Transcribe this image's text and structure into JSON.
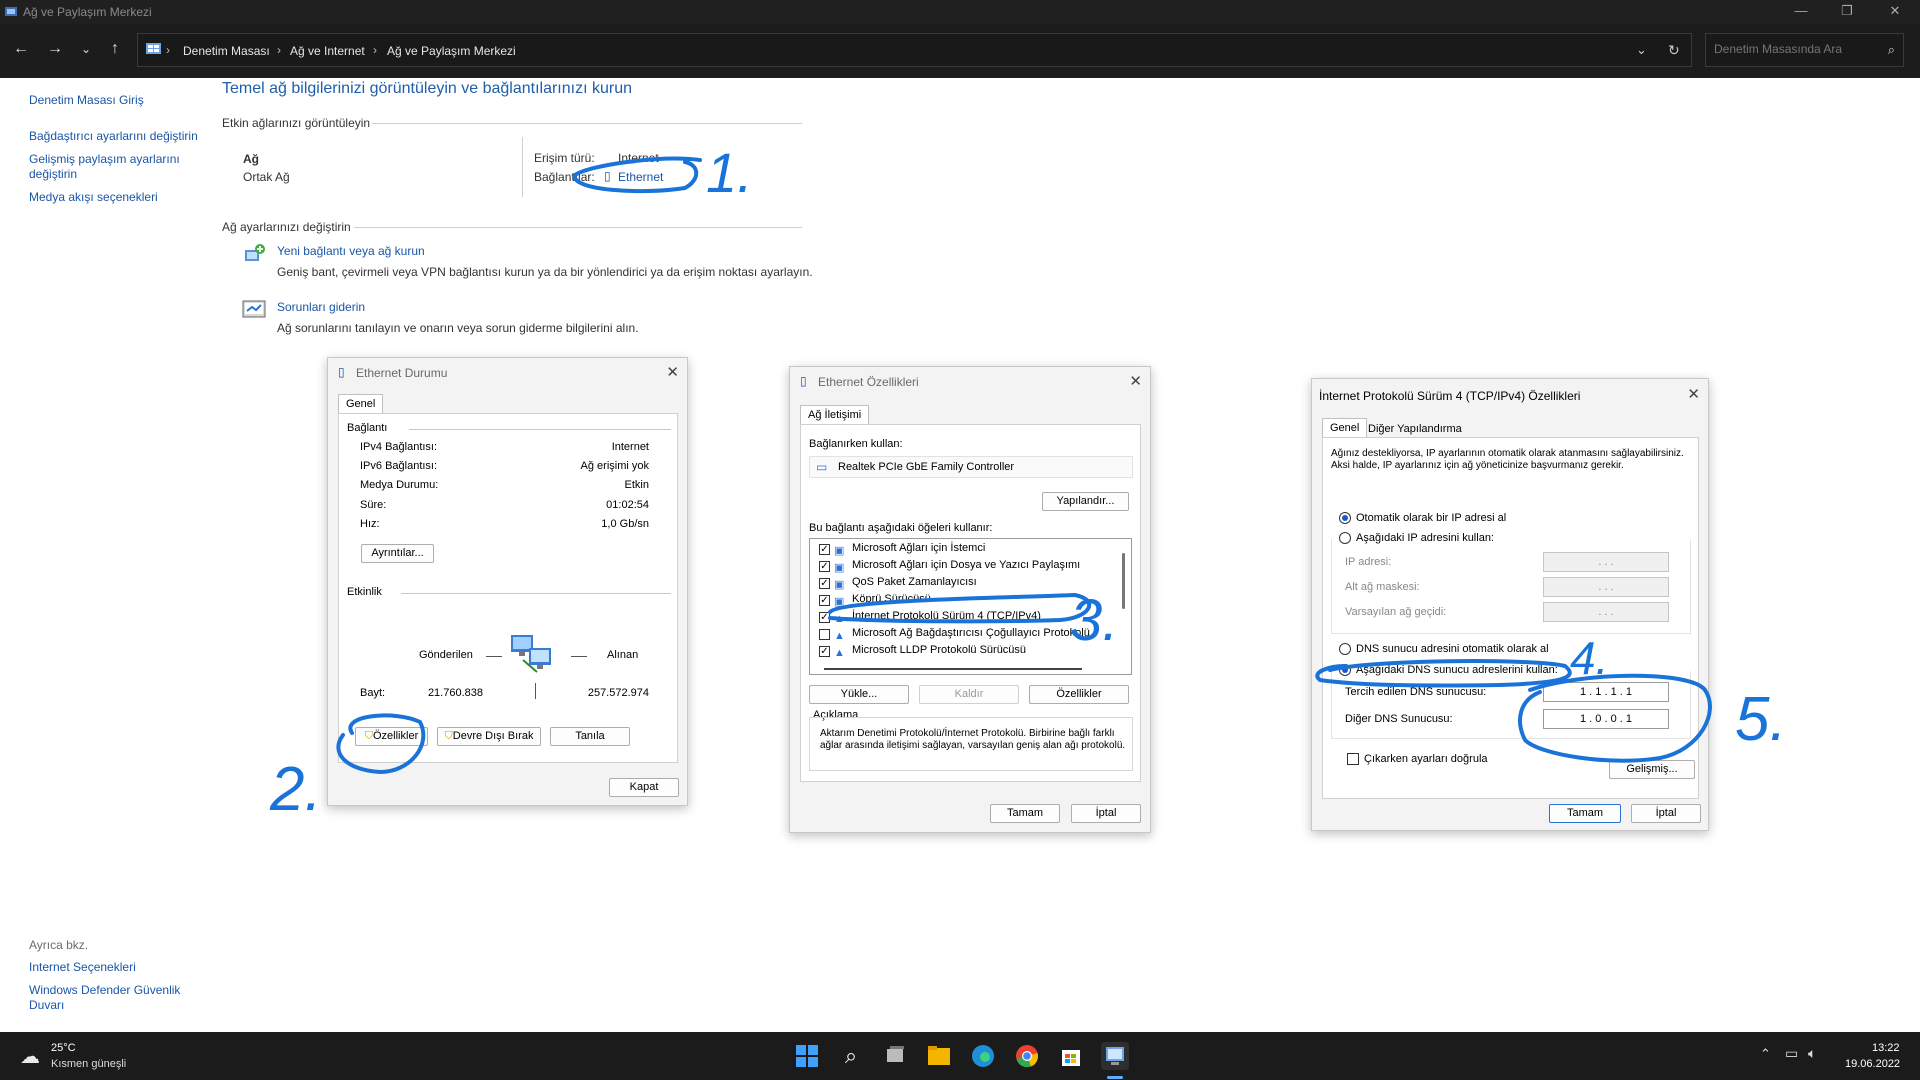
{
  "window": {
    "title": "Ağ ve Paylaşım Merkezi",
    "controls": {
      "minimize": "—",
      "maximize": "❐",
      "close": "✕"
    }
  },
  "address": {
    "crumbs": [
      "Denetim Masası",
      "Ağ ve Internet",
      "Ağ ve Paylaşım Merkezi"
    ],
    "search_placeholder": "Denetim Masasında Ara"
  },
  "sidebar": {
    "items": [
      "Denetim Masası Giriş",
      "Bağdaştırıcı ayarlarını değiştirin",
      "Gelişmiş paylaşım ayarlarını",
      "değiştirin",
      "Medya akışı seçenekleri"
    ],
    "see_also": "Ayrıca bkz.",
    "see_also_items": [
      "Internet Seçenekleri",
      "Windows Defender Güvenlik",
      "Duvarı"
    ]
  },
  "main": {
    "title": "Temel ağ bilgilerinizi görüntüleyin ve bağlantılarınızı kurun",
    "active_networks": "Etkin ağlarınızı görüntüleyin",
    "network_name": "Ağ",
    "network_type": "Ortak Ağ",
    "access_type_label": "Erişim türü:",
    "access_type_value": "Internet",
    "connections_label": "Bağlantılar:",
    "connections_value": "Ethernet",
    "change_settings": "Ağ ayarlarınızı değiştirin",
    "new_conn_link": "Yeni bağlantı veya ağ kurun",
    "new_conn_desc": "Geniş bant, çevirmeli veya VPN bağlantısı kurun ya da bir yönlendirici ya da erişim noktası ayarlayın.",
    "trouble_link": "Sorunları giderin",
    "trouble_desc": "Ağ sorunlarını tanılayın ve onarın veya sorun giderme bilgilerini alın."
  },
  "status_dialog": {
    "title": "Ethernet Durumu",
    "tab": "Genel",
    "conn_group": "Bağlantı",
    "rows": [
      {
        "k": "IPv4 Bağlantısı:",
        "v": "Internet"
      },
      {
        "k": "IPv6 Bağlantısı:",
        "v": "Ağ erişimi yok"
      },
      {
        "k": "Medya Durumu:",
        "v": "Etkin"
      },
      {
        "k": "Süre:",
        "v": "01:02:54"
      },
      {
        "k": "Hız:",
        "v": "1,0 Gb/sn"
      }
    ],
    "details_btn": "Ayrıntılar...",
    "activity_group": "Etkinlik",
    "sent": "Gönderilen",
    "received": "Alınan",
    "bytes_label": "Bayt:",
    "bytes_sent": "21.760.838",
    "bytes_recv": "257.572.974",
    "props_btn": "Özellikler",
    "disable_btn": "Devre Dışı Bırak",
    "diagnose_btn": "Tanıla",
    "close_btn": "Kapat"
  },
  "eth_props_dialog": {
    "title": "Ethernet Özellikleri",
    "tab": "Ağ İletişimi",
    "connect_using": "Bağlanırken kullan:",
    "adapter": "Realtek PCIe GbE Family Controller",
    "configure_btn": "Yapılandır...",
    "items_label": "Bu bağlantı aşağıdaki öğeleri kullanır:",
    "items": [
      {
        "label": "Microsoft Ağları için İstemci",
        "checked": true
      },
      {
        "label": "Microsoft Ağları için Dosya ve Yazıcı Paylaşımı",
        "checked": true
      },
      {
        "label": "QoS Paket Zamanlayıcısı",
        "checked": true
      },
      {
        "label": "Köprü Sürücüsü",
        "checked": true
      },
      {
        "label": "İnternet Protokolü Sürüm 4 (TCP/IPv4)",
        "checked": true
      },
      {
        "label": "Microsoft Ağ Bağdaştırıcısı Çoğullayıcı Protokolü",
        "checked": false
      },
      {
        "label": "Microsoft LLDP Protokolü Sürücüsü",
        "checked": true
      }
    ],
    "install_btn": "Yükle...",
    "uninstall_btn": "Kaldır",
    "props_btn": "Özellikler",
    "desc_group": "Açıklama",
    "desc": "Aktarım Denetimi Protokolü/İnternet Protokolü. Birbirine bağlı farklı ağlar arasında iletişimi sağlayan, varsayılan geniş alan ağı protokolü.",
    "ok_btn": "Tamam",
    "cancel_btn": "İptal"
  },
  "ipv4_dialog": {
    "title": "İnternet Protokolü Sürüm 4 (TCP/IPv4) Özellikleri",
    "tab_general": "Genel",
    "tab_alt": "Diğer Yapılandırma",
    "intro": "Ağınız destekliyorsa, IP ayarlarının otomatik olarak atanmasını sağlayabilirsiniz. Aksi halde, IP ayarlarınız için ağ yöneticinize başvurmanız gerekir.",
    "auto_ip": "Otomatik olarak bir IP adresi al",
    "manual_ip": "Aşağıdaki IP adresini kullan:",
    "ip_label": "IP adresi:",
    "mask_label": "Alt ağ maskesi:",
    "gw_label": "Varsayılan ağ geçidi:",
    "empty_ip": ". . .",
    "auto_dns": "DNS sunucu adresini otomatik olarak al",
    "manual_dns": "Aşağıdaki DNS sunucu adreslerini kullan:",
    "pref_dns_label": "Tercih edilen DNS sunucusu:",
    "alt_dns_label": "Diğer DNS Sunucusu:",
    "pref_dns": "1 . 1 . 1 . 1",
    "alt_dns": "1 . 0 . 0 . 1",
    "validate": "Çıkarken ayarları doğrula",
    "advanced_btn": "Gelişmiş...",
    "ok_btn": "Tamam",
    "cancel_btn": "İptal"
  },
  "annotations": [
    "1.",
    "2.",
    "3.",
    "4.",
    "5."
  ],
  "taskbar": {
    "temp": "25°C",
    "weather": "Kısmen güneşli",
    "time": "13:22",
    "date": "19.06.2022"
  },
  "colors": {
    "link": "#1a56a8",
    "annotation": "#1a73d8",
    "accent": "#2a72d6"
  }
}
